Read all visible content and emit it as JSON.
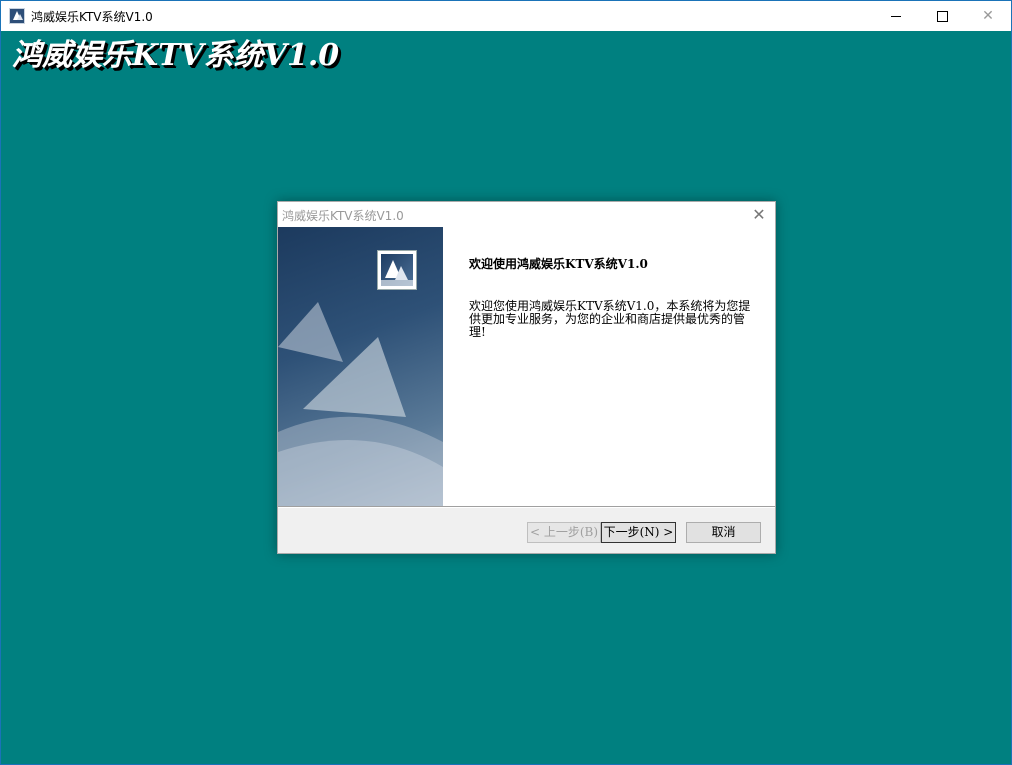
{
  "window": {
    "title": "鸿威娱乐KTV系统V1.0",
    "minimize_icon": "minimize-icon",
    "maximize_icon": "maximize-icon",
    "close_glyph": "✕"
  },
  "banner": {
    "text": "鸿威娱乐KTV系统V1.0"
  },
  "dialog": {
    "title": "鸿威娱乐KTV系统V1.0",
    "close_glyph": "✕",
    "heading": "欢迎使用鸿威娱乐KTV系统V1.0",
    "description": "欢迎您使用鸿威娱乐KTV系统V1.0，本系统将为您提供更加专业服务，为您的企业和商店提供最优秀的管理!",
    "buttons": {
      "back": "< 上一步(B)",
      "next": "下一步(N) >",
      "cancel": "取消"
    }
  },
  "colors": {
    "desktop": "#008080",
    "accent": "#1a73b8"
  }
}
